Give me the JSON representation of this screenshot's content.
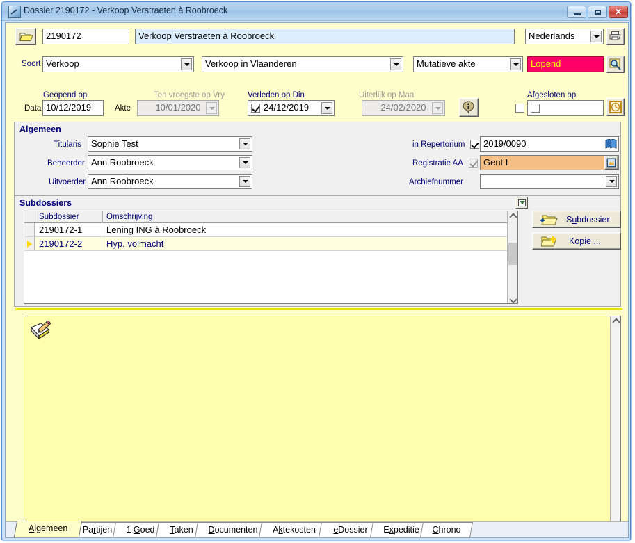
{
  "window": {
    "title": "Dossier 2190172 - Verkoop Verstraeten à Roobroeck",
    "icon": "app-icon",
    "minimize_label": "",
    "maximize_label": "",
    "close_label": "✕"
  },
  "header": {
    "open_folder_icon": "open-folder-icon",
    "dossier_number": "2190172",
    "dossier_description": "Verkoop Verstraeten à Roobroeck",
    "language": "Nederlands",
    "print_icon": "printer-icon",
    "soort_label": "Soort",
    "soort_value": "Verkoop",
    "soort_detail_value": "Verkoop in Vlaanderen",
    "akte_type_value": "Mutatieve akte",
    "status_value": "Lopend",
    "status_bg": "#ff0066",
    "status_fg": "#ffff00",
    "preview_icon": "search-preview-icon",
    "data_label": "Data",
    "akte_label": "Akte",
    "geopend_label": "Geopend op",
    "geopend_value": "10/12/2019",
    "vroegste_label": "Ten vroegste op Vry",
    "vroegste_value": "10/01/2020",
    "verleden_label": "Verleden op Din",
    "verleden_value": "24/12/2019",
    "verleden_checked": true,
    "uiterlijk_label": "Uiterlijk op Maa",
    "uiterlijk_value": "24/02/2020",
    "info_icon": "info-icon",
    "afgesloten_label": "Afgesloten op",
    "afgesloten_value": "",
    "afgesloten_checked": false,
    "afgesloten_outer_checked": false,
    "clock_icon": "clock-icon"
  },
  "algemeen": {
    "title": "Algemeen",
    "titularis_label": "Titularis",
    "titularis_value": "Sophie Test",
    "beheerder_label": "Beheerder",
    "beheerder_value": "Ann Roobroeck",
    "uitvoerder_label": "Uitvoerder",
    "uitvoerder_value": "Ann Roobroeck",
    "repertorium_label": "in Repertorium",
    "repertorium_checked": true,
    "repertorium_value": "2019/0090",
    "repertorium_icon": "book-icon",
    "registratie_label": "Registratie AA",
    "registratie_checked": true,
    "registratie_value": "Gent I",
    "registratie_bg": "#f5be84",
    "registratie_icon": "registration-icon",
    "archiefnummer_label": "Archiefnummer",
    "archiefnummer_value": ""
  },
  "subdossiers": {
    "title": "Subdossiers",
    "expand_icon": "collapse-all-icon",
    "columns": [
      "Subdossier",
      "Omschrijving"
    ],
    "rows": [
      {
        "selected": false,
        "subdossier": "2190172-1",
        "omschrijving": "Lening ING à Roobroeck"
      },
      {
        "selected": true,
        "subdossier": "2190172-2",
        "omschrijving": "Hyp. volmacht"
      }
    ],
    "btn_subdossier": {
      "pre": "S",
      "accel": "u",
      "post": "bdossier",
      "icon": "folder-add-icon"
    },
    "btn_kopie": {
      "pre": "Ko",
      "accel": "p",
      "post": "ie ...",
      "icon": "folder-copy-icon"
    }
  },
  "notes": {
    "icon": "notepad-pencil-icon",
    "text": ""
  },
  "tabs": [
    {
      "pre": "",
      "accel": "A",
      "post": "lgemeen",
      "active": true
    },
    {
      "pre": "Pa",
      "accel": "r",
      "post": "tijen",
      "active": false
    },
    {
      "pre": "1 ",
      "accel": "G",
      "post": "oed",
      "active": false
    },
    {
      "pre": "",
      "accel": "T",
      "post": "aken",
      "active": false
    },
    {
      "pre": "",
      "accel": "D",
      "post": "ocumenten",
      "active": false
    },
    {
      "pre": "A",
      "accel": "k",
      "post": "tekosten",
      "active": false
    },
    {
      "pre": "",
      "accel": "e",
      "post": "Dossier",
      "active": false
    },
    {
      "pre": "E",
      "accel": "x",
      "post": "peditie",
      "active": false
    },
    {
      "pre": "",
      "accel": "C",
      "post": "hrono",
      "active": false
    }
  ]
}
